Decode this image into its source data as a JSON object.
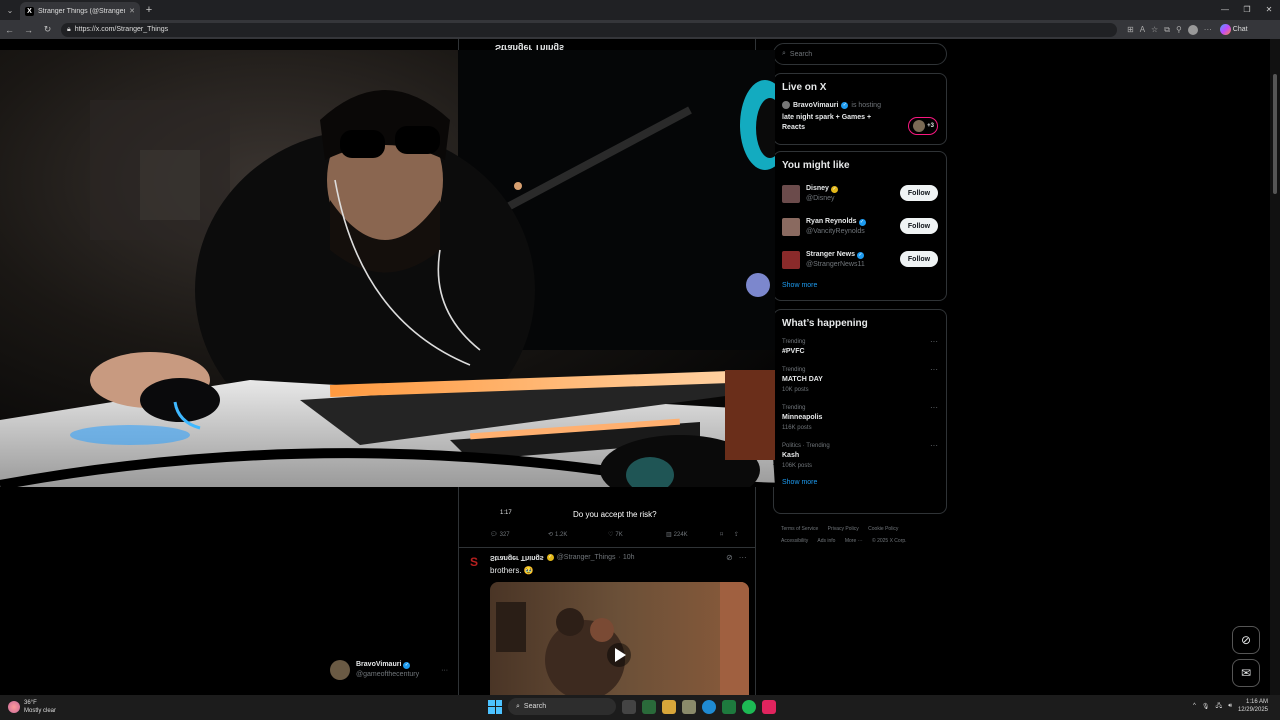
{
  "browser": {
    "tab_title": "Stranger Things (@Stranger_Things",
    "tab_favicon": "X",
    "url": "https://x.com/Stranger_Things",
    "chat_label": "Chat"
  },
  "feed": {
    "header_name": "Stranger Things",
    "video": {
      "duration": "1:17",
      "caption": "Do you accept the risk?"
    },
    "actions": {
      "replies": "327",
      "reposts": "1.2K",
      "likes": "7K",
      "views": "224K"
    },
    "tweet2": {
      "name": "Stranger Things",
      "handle": "@Stranger_Things",
      "time": "· 10h",
      "text": "brothers. 🥹"
    }
  },
  "sidebar": {
    "search_placeholder": "Search",
    "live": {
      "heading": "Live on X",
      "host": "BravoVimauri",
      "hosting": "is hosting",
      "title": "late night spark + Games + Reacts",
      "badge": "+3"
    },
    "you_might_like": {
      "heading": "You might like",
      "items": [
        {
          "name": "Disney",
          "handle": "@Disney",
          "follow": "Follow"
        },
        {
          "name": "Ryan Reynolds",
          "handle": "@VancityReynolds",
          "follow": "Follow"
        },
        {
          "name": "Stranger News",
          "handle": "@StrangerNews11",
          "follow": "Follow"
        }
      ],
      "show_more": "Show more"
    },
    "happening": {
      "heading": "What’s happening",
      "trends": [
        {
          "category": "Trending",
          "title": "#PVFC",
          "posts": ""
        },
        {
          "category": "Trending",
          "title": "MATCH DAY",
          "posts": "10K posts"
        },
        {
          "category": "Trending",
          "title": "Minneapolis",
          "posts": "116K posts"
        },
        {
          "category": "Politics · Trending",
          "title": "Kash",
          "posts": "106K posts"
        }
      ],
      "show_more": "Show more"
    },
    "footer": [
      "Terms of Service",
      "Privacy Policy",
      "Cookie Policy",
      "Accessibility",
      "Ads info",
      "More ···",
      "© 2025 X Corp."
    ]
  },
  "account": {
    "name": "BravoVimauri",
    "handle": "@gameofthecentury"
  },
  "taskbar": {
    "temp": "36°F",
    "condition": "Mostly clear",
    "search": "Search",
    "time": "1:16 AM",
    "date": "12/29/2025"
  },
  "colors": {
    "accent": "#1d9bf0",
    "live": "#f91880",
    "background": "#000000"
  }
}
